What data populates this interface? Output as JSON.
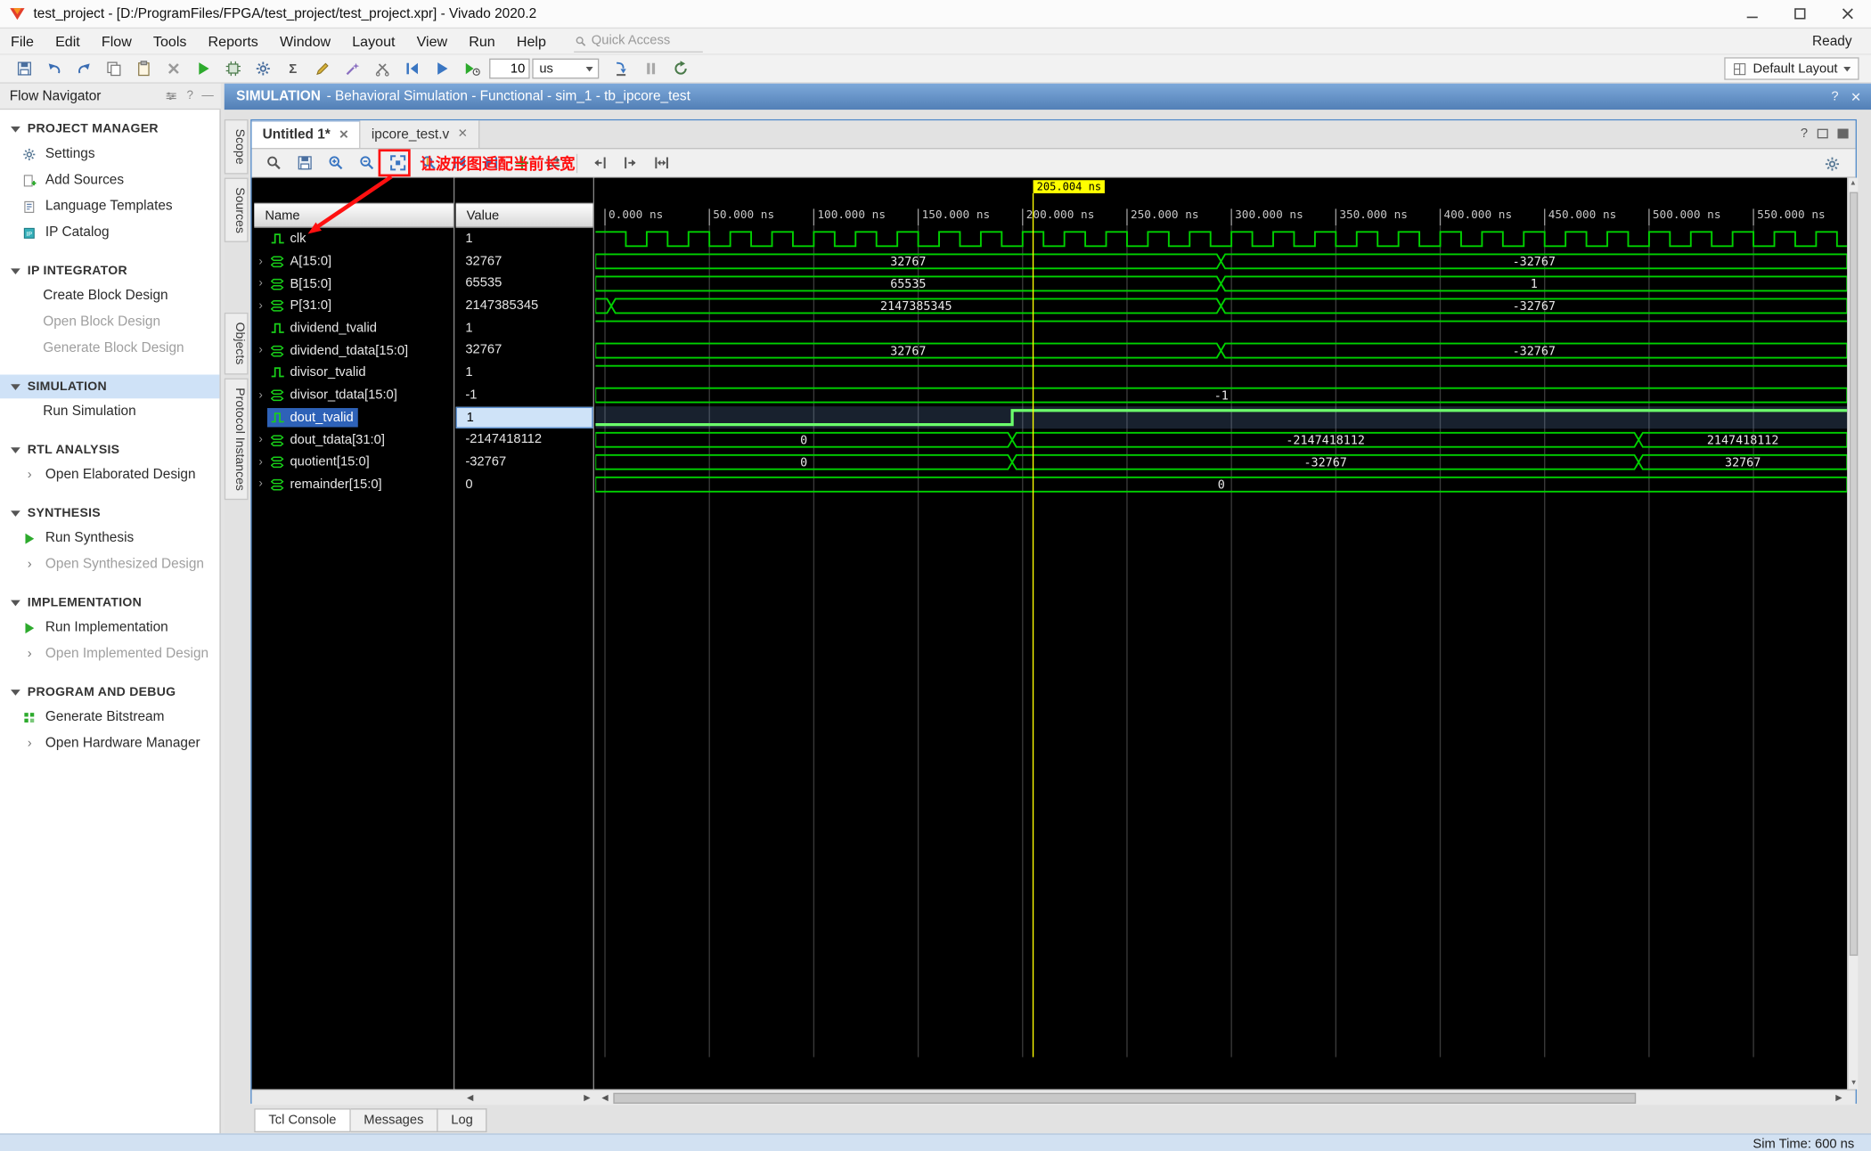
{
  "colors": {
    "wave_green": "#00D200",
    "wave_green_selected": "#6CFF6C",
    "cursor_yellow": "#FFFF00",
    "annotation_red": "#FF1010",
    "selection_blue": "#2E62B8",
    "context_bar_blue": "#527FB6"
  },
  "window": {
    "title": "test_project - [D:/ProgramFiles/FPGA/test_project/test_project.xpr] - Vivado 2020.2",
    "controls": [
      "minimize",
      "maximize",
      "close"
    ],
    "status_right": "Ready"
  },
  "menu_bar": {
    "items": [
      "File",
      "Edit",
      "Flow",
      "Tools",
      "Reports",
      "Window",
      "Layout",
      "View",
      "Run",
      "Help"
    ],
    "quick_access_placeholder": "Quick Access"
  },
  "main_toolbar": {
    "left_icons": [
      "save",
      "undo",
      "redo",
      "copy",
      "paste",
      "delete",
      "run",
      "board",
      "settings",
      "sigma",
      "edit",
      "wand",
      "probe",
      "restart",
      "run-all",
      "run-for"
    ],
    "time_value": "10",
    "time_unit": "us",
    "right_icons": [
      "step",
      "pause",
      "relaunch"
    ],
    "layout_selector": "Default Layout"
  },
  "context_bar": {
    "title": "SIMULATION",
    "subtitle": "- Behavioral Simulation - Functional - sim_1 - tb_ipcore_test",
    "icons": [
      "help",
      "close"
    ]
  },
  "flow_navigator": {
    "title": "Flow Navigator",
    "sections": [
      {
        "label": "PROJECT MANAGER",
        "items": [
          {
            "label": "Settings",
            "icon": "gear",
            "enabled": true
          },
          {
            "label": "Add Sources",
            "icon": "add-doc",
            "enabled": true
          },
          {
            "label": "Language Templates",
            "icon": "doc",
            "enabled": true
          },
          {
            "label": "IP Catalog",
            "icon": "ip",
            "enabled": true
          }
        ]
      },
      {
        "label": "IP INTEGRATOR",
        "items": [
          {
            "label": "Create Block Design",
            "enabled": true
          },
          {
            "label": "Open Block Design",
            "enabled": false
          },
          {
            "label": "Generate Block Design",
            "enabled": false
          }
        ]
      },
      {
        "label": "SIMULATION",
        "selected": true,
        "items": [
          {
            "label": "Run Simulation",
            "enabled": true
          }
        ]
      },
      {
        "label": "RTL ANALYSIS",
        "items": [
          {
            "label": "Open Elaborated Design",
            "chevron": true,
            "enabled": true
          }
        ]
      },
      {
        "label": "SYNTHESIS",
        "items": [
          {
            "label": "Run Synthesis",
            "icon": "run",
            "enabled": true
          },
          {
            "label": "Open Synthesized Design",
            "chevron": true,
            "enabled": false
          }
        ]
      },
      {
        "label": "IMPLEMENTATION",
        "items": [
          {
            "label": "Run Implementation",
            "icon": "run",
            "enabled": true
          },
          {
            "label": "Open Implemented Design",
            "chevron": true,
            "enabled": false
          }
        ]
      },
      {
        "label": "PROGRAM AND DEBUG",
        "items": [
          {
            "label": "Generate Bitstream",
            "icon": "bitstream",
            "enabled": true
          },
          {
            "label": "Open Hardware Manager",
            "chevron": true,
            "enabled": true
          }
        ]
      }
    ]
  },
  "editor": {
    "tabs": [
      {
        "label": "Untitled 1*",
        "active": true
      },
      {
        "label": "ipcore_test.v",
        "active": false
      }
    ],
    "side_tabs_top": [
      "Scope",
      "Sources"
    ],
    "side_tabs_bottom": [
      "Objects",
      "Protocol Instances"
    ],
    "wave_toolbar_icons": [
      "find",
      "save",
      "zoom-in",
      "zoom-out",
      "zoom-fit",
      "zoom-cursor",
      "prev-transition",
      "next-transition",
      "add-marker",
      "swap-cursor"
    ],
    "wave_toolbar_icons_right": [
      "goto-start",
      "goto-end",
      "fit"
    ],
    "annotation": {
      "text": "让波形图适配当前长宽",
      "target": "zoom-fit-button"
    },
    "name_header": "Name",
    "value_header": "Value"
  },
  "wave": {
    "cursor": {
      "time_ns": 205.004,
      "label": "205.004 ns"
    },
    "time_end_ns": 595,
    "ticks": [
      {
        "t": 0,
        "label": "0.000 ns"
      },
      {
        "t": 50,
        "label": "50.000 ns"
      },
      {
        "t": 100,
        "label": "100.000 ns"
      },
      {
        "t": 150,
        "label": "150.000 ns"
      },
      {
        "t": 200,
        "label": "200.000 ns"
      },
      {
        "t": 250,
        "label": "250.000 ns"
      },
      {
        "t": 300,
        "label": "300.000 ns"
      },
      {
        "t": 350,
        "label": "350.000 ns"
      },
      {
        "t": 400,
        "label": "400.000 ns"
      },
      {
        "t": 450,
        "label": "450.000 ns"
      },
      {
        "t": 500,
        "label": "500.000 ns"
      },
      {
        "t": 550,
        "label": "550.000 ns"
      }
    ],
    "signals": [
      {
        "name": "clk",
        "value": "1",
        "type": "clock",
        "period_ns": 20,
        "start_level": 1
      },
      {
        "name": "A[15:0]",
        "value": "32767",
        "type": "bus",
        "expandable": true,
        "segments": [
          {
            "t0": 0,
            "t1": 295,
            "label": "32767"
          },
          {
            "t0": 295,
            "t1": 595,
            "label": "-32767"
          }
        ]
      },
      {
        "name": "B[15:0]",
        "value": "65535",
        "type": "bus",
        "expandable": true,
        "segments": [
          {
            "t0": 0,
            "t1": 295,
            "label": "65535"
          },
          {
            "t0": 295,
            "t1": 595,
            "label": "1"
          }
        ]
      },
      {
        "name": "P[31:0]",
        "value": "2147385345",
        "type": "bus",
        "expandable": true,
        "segments": [
          {
            "t0": 0,
            "t1": 3,
            "label": ""
          },
          {
            "t0": 3,
            "t1": 295,
            "label": "2147385345"
          },
          {
            "t0": 295,
            "t1": 595,
            "label": "-32767"
          }
        ]
      },
      {
        "name": "dividend_tvalid",
        "value": "1",
        "type": "scalar",
        "levels": [
          {
            "t0": 0,
            "t1": 595,
            "v": 1
          }
        ]
      },
      {
        "name": "dividend_tdata[15:0]",
        "value": "32767",
        "type": "bus",
        "expandable": true,
        "segments": [
          {
            "t0": 0,
            "t1": 295,
            "label": "32767"
          },
          {
            "t0": 295,
            "t1": 595,
            "label": "-32767"
          }
        ]
      },
      {
        "name": "divisor_tvalid",
        "value": "1",
        "type": "scalar",
        "levels": [
          {
            "t0": 0,
            "t1": 595,
            "v": 1
          }
        ]
      },
      {
        "name": "divisor_tdata[15:0]",
        "value": "-1",
        "type": "bus",
        "expandable": true,
        "segments": [
          {
            "t0": 0,
            "t1": 595,
            "label": "-1"
          }
        ]
      },
      {
        "name": "dout_tvalid",
        "value": "1",
        "type": "scalar",
        "selected": true,
        "levels": [
          {
            "t0": 0,
            "t1": 195,
            "v": 0
          },
          {
            "t0": 195,
            "t1": 595,
            "v": 1
          }
        ]
      },
      {
        "name": "dout_tdata[31:0]",
        "value": "-2147418112",
        "type": "bus",
        "expandable": true,
        "segments": [
          {
            "t0": 0,
            "t1": 195,
            "label": "0"
          },
          {
            "t0": 195,
            "t1": 495,
            "label": "-2147418112"
          },
          {
            "t0": 495,
            "t1": 595,
            "label": "2147418112"
          }
        ]
      },
      {
        "name": "quotient[15:0]",
        "value": "-32767",
        "type": "bus",
        "expandable": true,
        "segments": [
          {
            "t0": 0,
            "t1": 195,
            "label": "0"
          },
          {
            "t0": 195,
            "t1": 495,
            "label": "-32767"
          },
          {
            "t0": 495,
            "t1": 595,
            "label": "32767"
          }
        ]
      },
      {
        "name": "remainder[15:0]",
        "value": "0",
        "type": "bus",
        "expandable": true,
        "segments": [
          {
            "t0": 0,
            "t1": 595,
            "label": "0"
          }
        ]
      }
    ]
  },
  "console": {
    "tabs": [
      {
        "label": "Tcl Console",
        "active": true
      },
      {
        "label": "Messages",
        "active": false
      },
      {
        "label": "Log",
        "active": false
      }
    ]
  },
  "status_bar": {
    "sim_time": "Sim Time: 600 ns"
  }
}
